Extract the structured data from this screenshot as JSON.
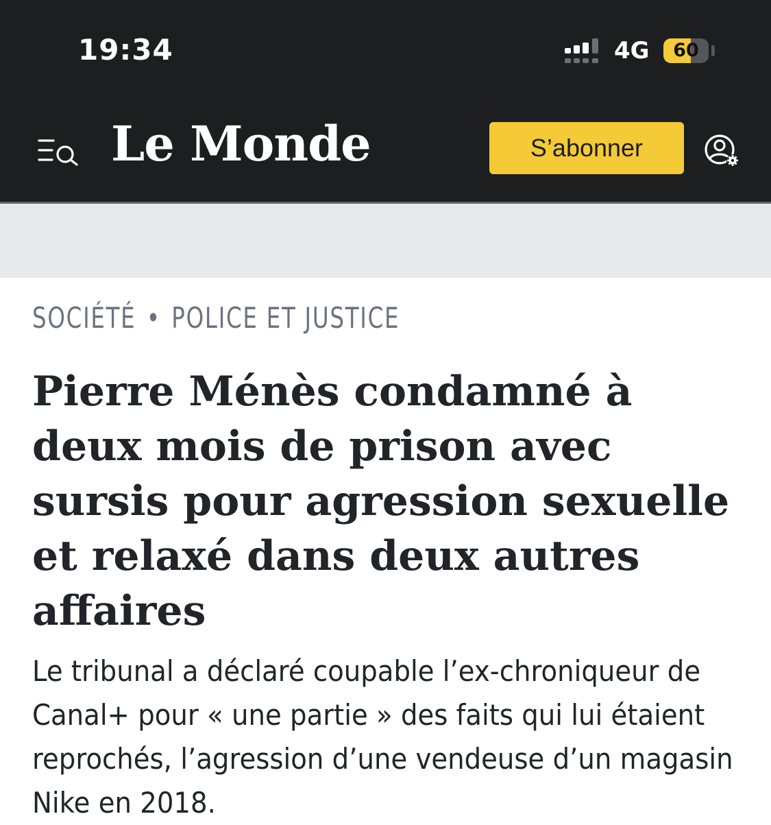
{
  "status_bar": {
    "time": "19:34",
    "network": "4G",
    "battery_level": 60,
    "battery_text": "60",
    "battery_color": "#f4cb36",
    "signal_icon": "cellular-signal-icon"
  },
  "header": {
    "logo": "Le Monde",
    "subscribe_label": "S’abonner",
    "menu_icon": "menu-search-icon",
    "account_icon": "account-settings-icon",
    "background_color": "#1d1e20",
    "accent_color": "#f4cb36"
  },
  "article": {
    "section": "SOCIÉTÉ",
    "separator": "•",
    "subsection": "POLICE ET JUSTICE",
    "headline": "Pierre Ménès condamné à deux mois de prison avec sursis pour agression sexuelle et relaxé dans deux autres affaires",
    "standfirst": "Le tribunal a déclaré coupable l’ex-chroniqueur de Canal+ pour « une partie » des faits qui lui étaient reprochés, l’agression d’une vendeuse d’un magasin Nike en 2018."
  }
}
